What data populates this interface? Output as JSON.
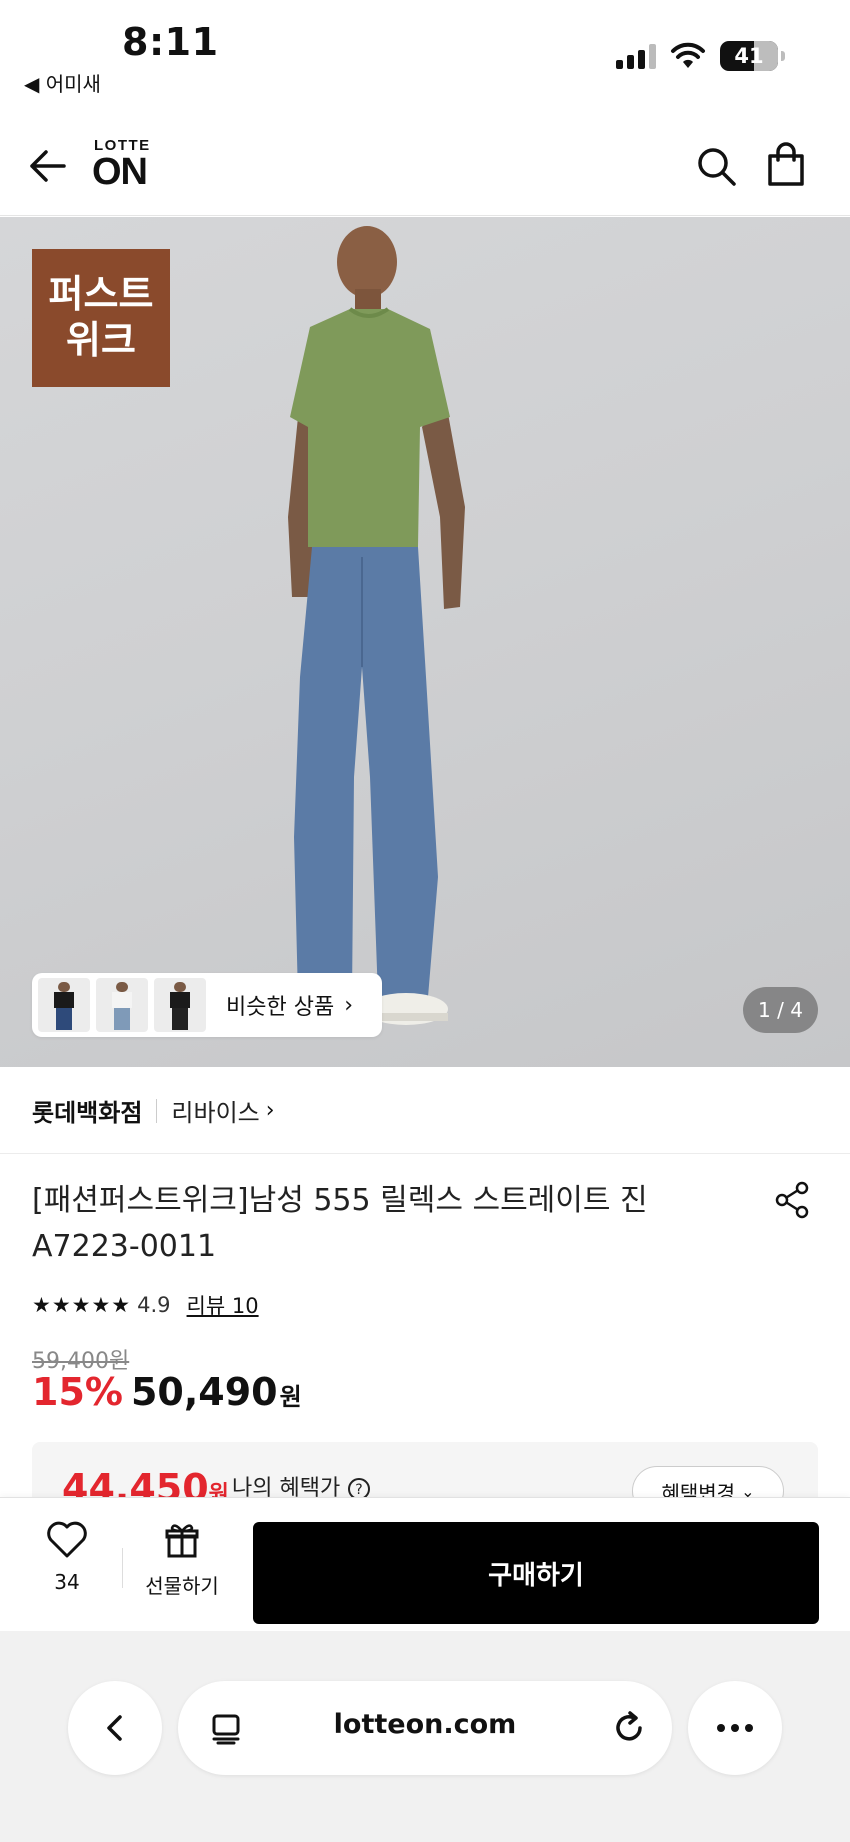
{
  "status_bar": {
    "time": "8:11",
    "back_app": "◀ 어미새",
    "battery": "41"
  },
  "header": {
    "logo_top": "LOTTE",
    "logo_bottom": "ON"
  },
  "hero": {
    "badge_line1": "퍼스트",
    "badge_line2": "위크",
    "similar_label": "비슷한 상품",
    "page_indicator": "1 / 4",
    "shirt_color": "#7f9a5a",
    "jeans_color": "#5b7ba6",
    "badge_color": "#8a4a2c"
  },
  "seller": {
    "store": "롯데백화점",
    "brand": "리바이스"
  },
  "product": {
    "title_line1": "[패션퍼스트위크]남성 555 릴렉스 스트레이트 진",
    "title_line2": "A7223-0011",
    "stars": "★★★★★",
    "rating": "4.9",
    "review": "리뷰 10",
    "original_price": "59,400원",
    "discount": "15%",
    "sale_price": "50,490",
    "won": "원"
  },
  "benefit": {
    "price": "44,450",
    "won": "원",
    "label": "나의 혜택가",
    "change_button": "혜택변경"
  },
  "action_bar": {
    "like_count": "34",
    "gift_label": "선물하기",
    "buy_label": "구매하기"
  },
  "browser": {
    "url": "lotteon.com"
  },
  "colors": {
    "accent_red": "#e3262e",
    "buy_button": "#000000"
  }
}
